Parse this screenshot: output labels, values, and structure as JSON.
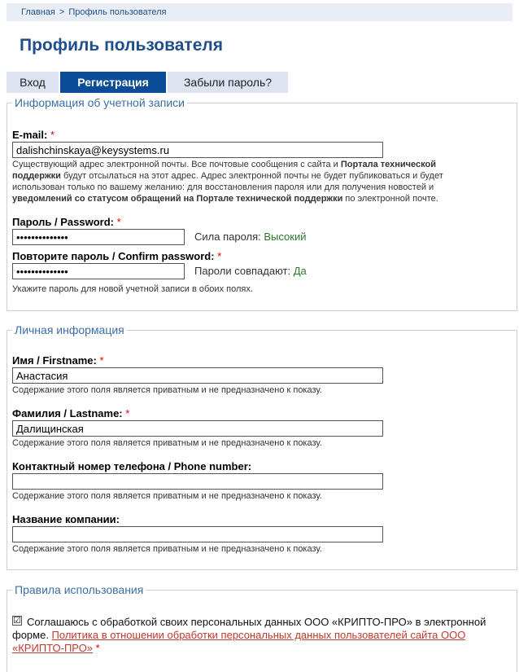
{
  "breadcrumb": {
    "home": "Главная",
    "separator": ">",
    "current": "Профиль пользователя"
  },
  "page": {
    "title": "Профиль пользователя"
  },
  "tabs": [
    {
      "label": "Вход",
      "active": false
    },
    {
      "label": "Регистрация",
      "active": true
    },
    {
      "label": "Забыли пароль?",
      "active": false
    }
  ],
  "account": {
    "legend": "Информация об учетной записи",
    "email_label": "E-mail:",
    "required_mark": "*",
    "email_value": "dalishchinskaya@keysystems.ru",
    "email_desc_1": "Существующий адрес электронной почты. Все почтовые сообщения с сайта и ",
    "email_desc_b1": "Портала технической",
    "email_desc_b2": "поддержки",
    "email_desc_2": " будут отсылаться на этот адрес. Адрес электронной почты не будет публиковаться и будет",
    "email_desc_3": "использован только по вашему желанию: для восстановления пароля или для получения новостей и",
    "email_desc_b3": "уведомлений со статусом обращений на Портале технической поддержки",
    "email_desc_4": " по электронной почте.",
    "password_label": "Пароль / Password:",
    "password_value": "••••••••••••••",
    "strength_label": "Сила пароля:",
    "strength_value": "Высокий",
    "confirm_label": "Повторите пароль / Confirm password:",
    "confirm_value": "••••••••••••••",
    "match_label": "Пароли совпадают:",
    "match_value": "Да",
    "password_hint": "Укажите пароль для новой учетной записи в обоих полях."
  },
  "personal": {
    "legend": "Личная информация",
    "firstname_label": "Имя / Firstname:",
    "firstname_value": "Анастасия",
    "lastname_label": "Фамилия / Lastname:",
    "lastname_value": "Далищинская",
    "phone_label": "Контактный номер телефона / Phone number:",
    "phone_value": "",
    "company_label": "Название компании:",
    "company_value": "",
    "private_note": "Содержание этого поля является приватным и не предназначено к показу."
  },
  "terms": {
    "legend": "Правила использования",
    "checked": "☑",
    "text": "Соглашаюсь с обработкой своих персональных данных ООО «КРИПТО-ПРО» в электронной форме. ",
    "link": "Политика в отношении обработки персональных данных пользователей сайта ООО «КРИПТО-ПРО»"
  }
}
